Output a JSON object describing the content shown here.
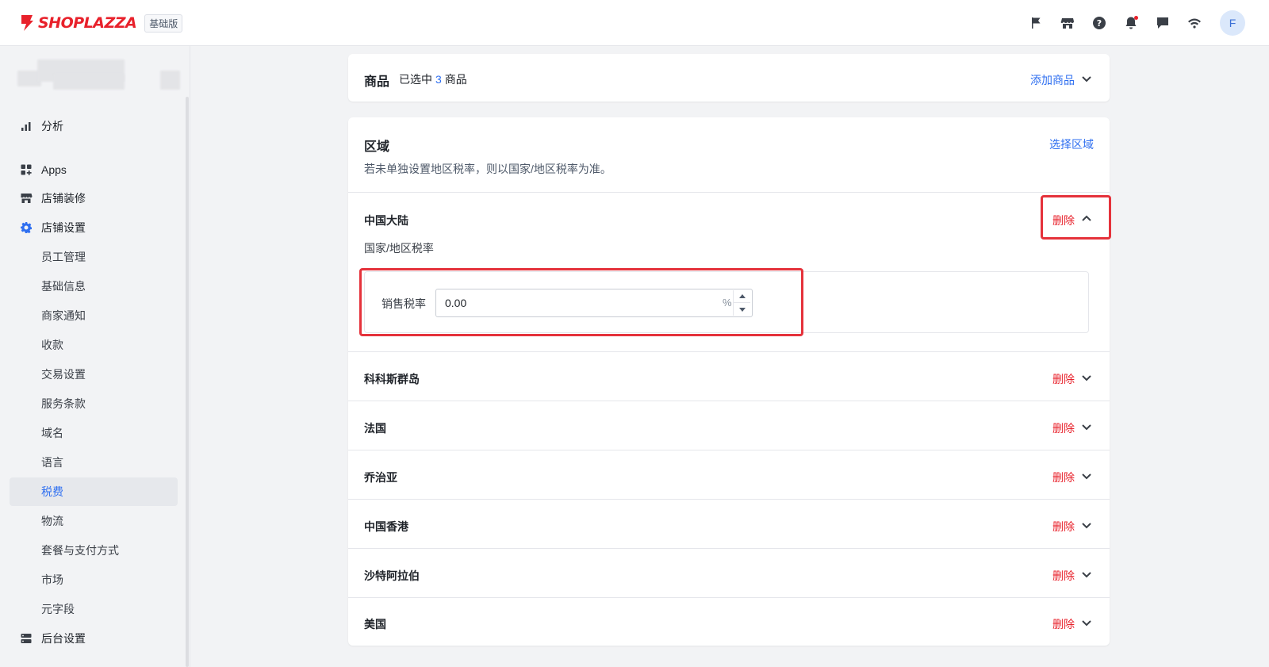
{
  "header": {
    "brand": "SHOPLAZZA",
    "plan_badge": "基础版",
    "icons": [
      "flag-icon",
      "store-icon",
      "help-icon",
      "bell-icon",
      "chat-icon",
      "wifi-icon"
    ],
    "avatar_letter": "F"
  },
  "sidebar": {
    "items": [
      {
        "label": "分析",
        "icon": "bar-chart-icon"
      },
      {
        "label": "Apps",
        "icon": "apps-icon"
      },
      {
        "label": "店铺装修",
        "icon": "store-icon"
      },
      {
        "label": "店铺设置",
        "icon": "gear-icon"
      }
    ],
    "settings_children": [
      "员工管理",
      "基础信息",
      "商家通知",
      "收款",
      "交易设置",
      "服务条款",
      "域名",
      "语言",
      "税费",
      "物流",
      "套餐与支付方式",
      "市场",
      "元字段"
    ],
    "active_child": "税费",
    "footer_item": {
      "label": "后台设置",
      "icon": "server-icon"
    }
  },
  "products": {
    "title": "商品",
    "selected_prefix": "已选中",
    "selected_count": "3",
    "selected_suffix": "商品",
    "add_label": "添加商品"
  },
  "regions": {
    "title": "区域",
    "select_label": "选择区域",
    "description": "若未单独设置地区税率，则以国家/地区税率为准。",
    "delete_label": "删除",
    "expanded": {
      "name": "中国大陆",
      "subtitle": "国家/地区税率",
      "tax_label": "销售税率",
      "tax_value": "0.00",
      "tax_unit": "%"
    },
    "list": [
      "科科斯群岛",
      "法国",
      "乔治亚",
      "中国香港",
      "沙特阿拉伯",
      "美国"
    ]
  },
  "colors": {
    "accent": "#2f6ff0",
    "danger": "#e8212b",
    "annotation": "#e5323b"
  }
}
